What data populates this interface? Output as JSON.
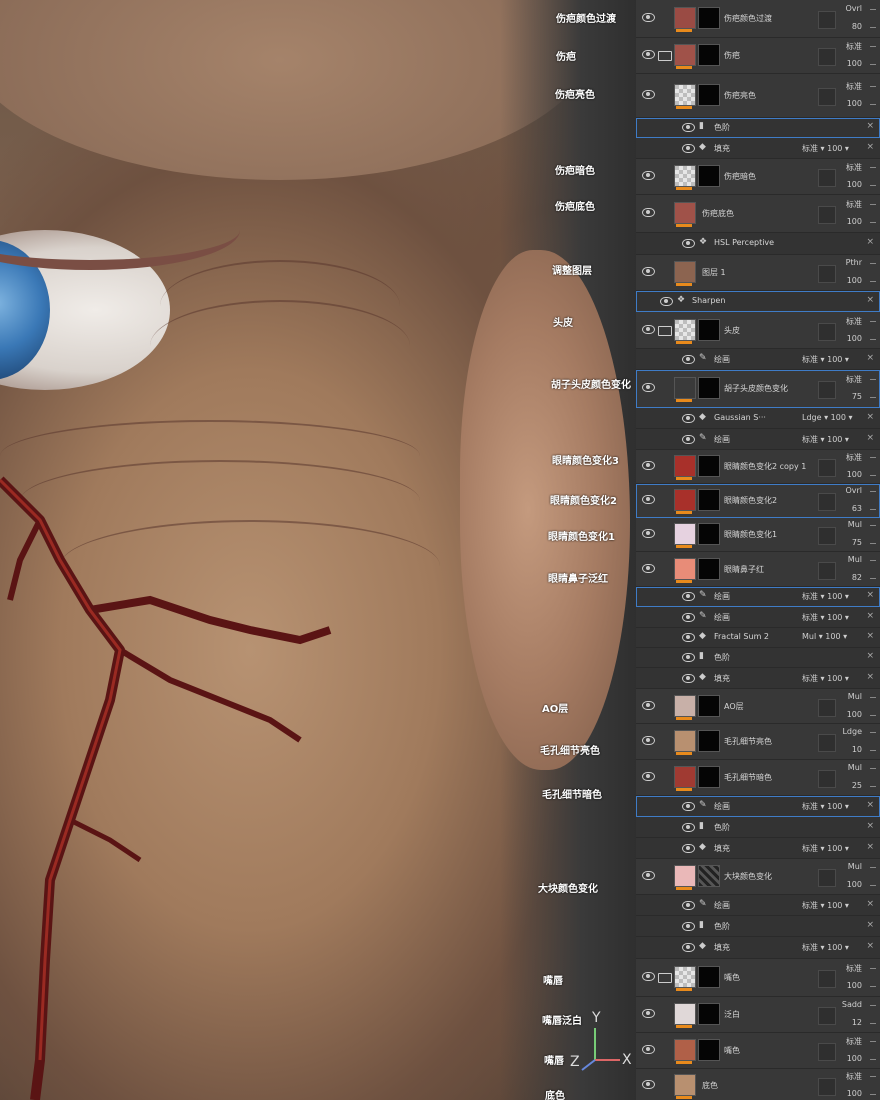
{
  "overlay_labels": [
    "伤疤颜色过渡",
    "伤疤",
    "伤疤亮色",
    "伤疤暗色",
    "伤疤底色",
    "调整图层",
    "头皮",
    "胡子头皮颜色变化",
    "眼睛颜色变化3",
    "眼睛颜色变化2",
    "眼睛颜色变化1",
    "眼睛鼻子泛红",
    "AO层",
    "毛孔细节亮色",
    "毛孔细节暗色",
    "大块颜色变化",
    "嘴唇",
    "嘴唇泛白",
    "嘴唇",
    "底色"
  ],
  "gizmo": {
    "y": "Y",
    "z": "Z",
    "x": "X"
  },
  "layers": [
    {
      "name": "伤疤颜色过渡",
      "mode": "Ovrl",
      "opacity": "80",
      "thumb": "#9a4b44",
      "mask": "black"
    },
    {
      "name": "伤疤",
      "mode": "标准",
      "opacity": "100",
      "thumb": "#a05249",
      "mask": "black",
      "folder": true
    },
    {
      "name": "伤疤亮色",
      "mode": "标准",
      "opacity": "100",
      "thumb": "checker",
      "mask": "black"
    },
    {
      "name": "色阶",
      "sub": true,
      "icon": "levels",
      "sel": true
    },
    {
      "name": "填充",
      "sub": true,
      "icon": "fill",
      "mode": "标准",
      "opacity": "100"
    },
    {
      "name": "伤疤暗色",
      "mode": "标准",
      "opacity": "100",
      "thumb": "checker",
      "mask": "black"
    },
    {
      "name": "伤疤底色",
      "mode": "标准",
      "opacity": "100",
      "thumb": "#a05249",
      "mask": "none"
    },
    {
      "name": "HSL Perceptive",
      "sub": true,
      "icon": "filter"
    },
    {
      "name": "图层 1",
      "mode": "Pthr",
      "opacity": "100",
      "thumb": "#8c6450",
      "mask": "none"
    },
    {
      "name": "Sharpen",
      "sub": true,
      "icon": "filter",
      "sel": true
    },
    {
      "name": "头皮",
      "mode": "标准",
      "opacity": "100",
      "thumb": "checker",
      "mask": "black",
      "folder": true
    },
    {
      "name": "绘画",
      "sub": true,
      "icon": "paint",
      "mode": "标准",
      "opacity": "100"
    },
    {
      "name": "胡子头皮颜色变化",
      "mode": "标准",
      "opacity": "75",
      "thumb": "#3a3a3a",
      "mask": "black",
      "sel": true
    },
    {
      "name": "Gaussian S···",
      "sub": true,
      "icon": "fill",
      "mode": "Ldge",
      "opacity": "100"
    },
    {
      "name": "绘画",
      "sub": true,
      "icon": "paint",
      "mode": "标准",
      "opacity": "100"
    },
    {
      "name": "眼睛颜色变化2 copy 1",
      "mode": "标准",
      "opacity": "100",
      "thumb": "#a8302a",
      "mask": "black"
    },
    {
      "name": "眼睛颜色变化2",
      "mode": "Ovrl",
      "opacity": "63",
      "thumb": "#a8302a",
      "mask": "black",
      "sel": true
    },
    {
      "name": "眼睛颜色变化1",
      "mode": "Mul",
      "opacity": "75",
      "thumb": "#e6d2e0",
      "mask": "black"
    },
    {
      "name": "眼睛鼻子红",
      "mode": "Mul",
      "opacity": "82",
      "thumb": "#e88c78",
      "mask": "black"
    },
    {
      "name": "绘画",
      "sub": true,
      "icon": "paint",
      "mode": "标准",
      "opacity": "100",
      "sel": true
    },
    {
      "name": "绘画",
      "sub": true,
      "icon": "paint",
      "mode": "标准",
      "opacity": "100"
    },
    {
      "name": "Fractal Sum 2",
      "sub": true,
      "icon": "fill",
      "mode": "Mul",
      "opacity": "100"
    },
    {
      "name": "色阶",
      "sub": true,
      "icon": "levels"
    },
    {
      "name": "填充",
      "sub": true,
      "icon": "fill",
      "mode": "标准",
      "opacity": "100"
    },
    {
      "name": "AO层",
      "mode": "Mul",
      "opacity": "100",
      "thumb": "#c8b0a8",
      "mask": "black"
    },
    {
      "name": "毛孔细节亮色",
      "mode": "Ldge",
      "opacity": "10",
      "thumb": "#b89070",
      "mask": "black"
    },
    {
      "name": "毛孔细节暗色",
      "mode": "Mul",
      "opacity": "25",
      "thumb": "#a03a32",
      "mask": "black"
    },
    {
      "name": "绘画",
      "sub": true,
      "icon": "paint",
      "mode": "标准",
      "opacity": "100",
      "sel": true
    },
    {
      "name": "色阶",
      "sub": true,
      "icon": "levels"
    },
    {
      "name": "填充",
      "sub": true,
      "icon": "fill",
      "mode": "标准",
      "opacity": "100"
    },
    {
      "name": "大块颜色变化",
      "mode": "Mul",
      "opacity": "100",
      "thumb": "#eab8b8",
      "mask": "pattern"
    },
    {
      "name": "绘画",
      "sub": true,
      "icon": "paint",
      "mode": "标准",
      "opacity": "100"
    },
    {
      "name": "色阶",
      "sub": true,
      "icon": "levels"
    },
    {
      "name": "填充",
      "sub": true,
      "icon": "fill",
      "mode": "标准",
      "opacity": "100"
    },
    {
      "name": "嘴色",
      "mode": "标准",
      "opacity": "100",
      "thumb": "checker",
      "mask": "black",
      "folder": true
    },
    {
      "name": "泛白",
      "mode": "Sadd",
      "opacity": "12",
      "thumb": "#e0d8d8",
      "mask": "black"
    },
    {
      "name": "嘴色",
      "mode": "标准",
      "opacity": "100",
      "thumb": "#b06048",
      "mask": "black"
    },
    {
      "name": "底色",
      "mode": "标准",
      "opacity": "100",
      "thumb": "#b89070",
      "mask": "none"
    }
  ]
}
